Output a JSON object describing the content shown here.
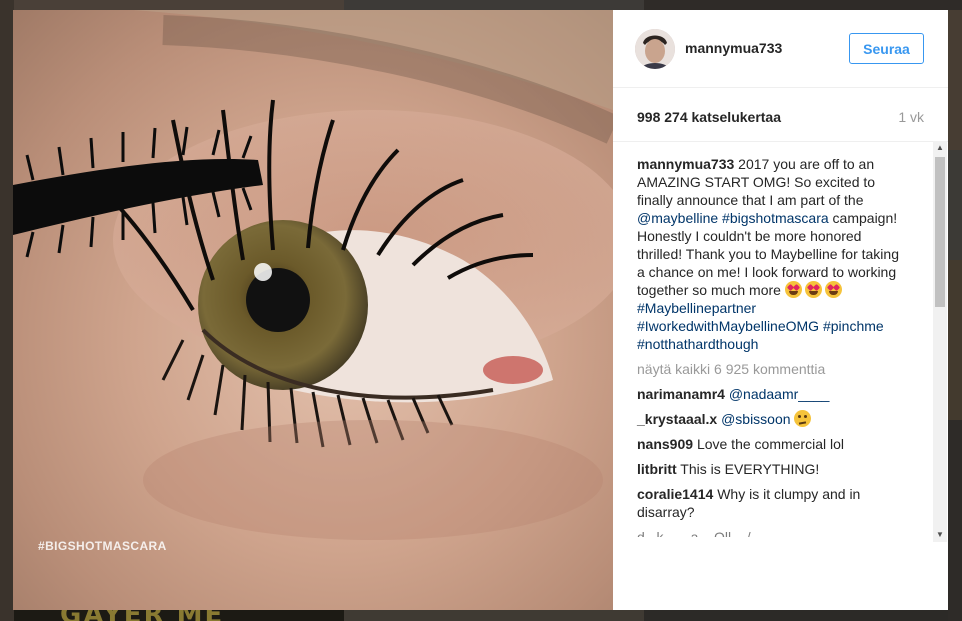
{
  "background": {
    "partial_word": "GAYER ME"
  },
  "media": {
    "hashtag_overlay": "#BIGSHOTMASCARA"
  },
  "header": {
    "username": "mannymua733",
    "follow_label": "Seuraa"
  },
  "stats": {
    "views": "998 274 katselukertaa",
    "age": "1 vk"
  },
  "caption": {
    "user": "mannymua733",
    "text_1": " 2017 you are off to an AMAZING START OMG! So excited to finally announce that I am part of the ",
    "mention": "@maybelline",
    "tag_1": "#bigshotmascara",
    "text_2": " campaign! Honestly I couldn't be more honored thrilled! Thank you to Maybelline for taking a chance on me! I look forward to working together so much more ",
    "tag_2": "#Maybellinepartner",
    "tag_3": "#IworkedwithMaybellineOMG",
    "tag_4": "#pinchme",
    "tag_5": "#notthathardthough"
  },
  "view_all": "näytä kaikki 6 925 kommenttia",
  "comments": [
    {
      "user": "narimanamr4",
      "mention": "@nadaamr____",
      "text": ""
    },
    {
      "user": "_krystaaal.x",
      "mention": "@sbissoon",
      "text": ""
    },
    {
      "user": "nans909",
      "mention": "",
      "text": "Love the commercial lol"
    },
    {
      "user": "litbritt",
      "mention": "",
      "text": "This is EVERYTHING!"
    },
    {
      "user": "coralie1414",
      "mention": "",
      "text": "Why is it clumpy and in disarray?"
    }
  ],
  "cut_off_line": "d...k... ...a... Oll... /...",
  "icons": {
    "emoji_heart_eyes": "smiling-face-with-heart-eyes-icon",
    "emoji_thinking": "thinking-face-icon"
  },
  "colors": {
    "accent": "#3897f0",
    "link": "#003569",
    "muted": "#999999"
  }
}
